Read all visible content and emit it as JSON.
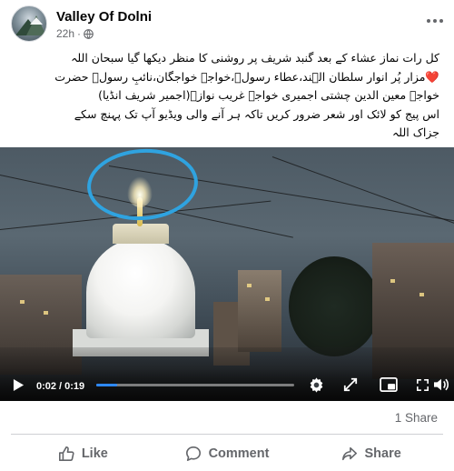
{
  "post": {
    "page_name": "Valley Of Dolni",
    "time_ago": "22h",
    "separator": "·",
    "text_lines": [
      "کل رات نماز عشاء کے بعد گنبد شریف پر روشنی کا منظر دیکھا گیا سبحان اللہ",
      "❤️مزار پُر انوار سلطان الہند،عطاء رسولؐ،خواجہ خواجگان،نائبِ رسولؐ حضرت",
      "خواجہ معین الدین چشتی اجمیری خواجہ غریب نوازؒ(اجمیر شریف انڈیا)",
      "اس پیج کو لائک اور شعر ضرور کریں تاکہ ہر آنے والی ویڈیو آپ تک پہنچ سکے",
      "جزاک اللہ"
    ]
  },
  "video": {
    "current_time": "0:02",
    "time_separator": "/",
    "duration": "0:19",
    "progress_fraction": 0.105,
    "highlight_color": "#2fa3e0",
    "progress_color": "#2d88ff"
  },
  "footer": {
    "share_count": "1 Share",
    "like_label": "Like",
    "comment_label": "Comment",
    "share_label": "Share"
  },
  "icons": [
    "globe-icon",
    "more-options-icon",
    "play-icon",
    "settings-icon",
    "expand-icon",
    "pip-icon",
    "fullscreen-icon",
    "volume-icon",
    "like-icon",
    "comment-icon",
    "share-icon"
  ]
}
